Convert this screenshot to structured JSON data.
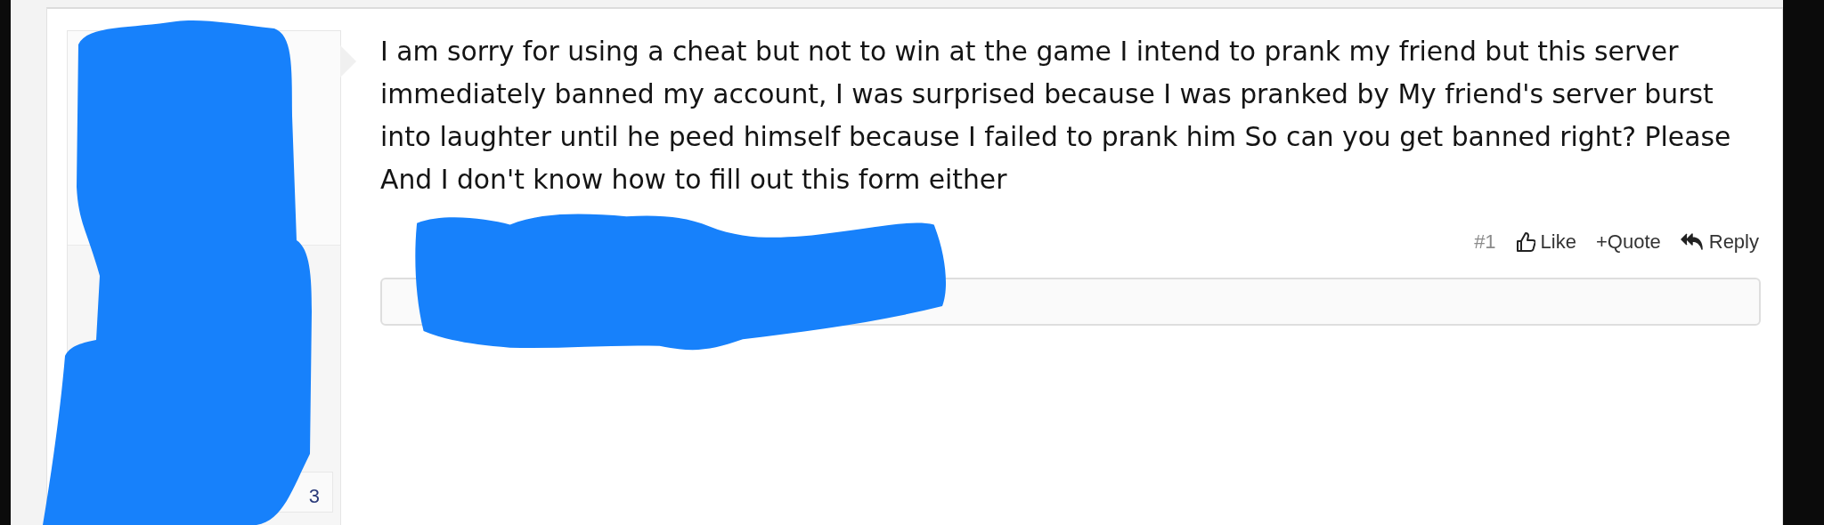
{
  "post": {
    "author": {
      "stat_value": "3"
    },
    "message": "I am sorry for using a cheat but not to win at the game I intend to prank my friend but this server immediately banned my account, I was surprised because I was pranked by My friend's server burst into laughter until he peed himself because I failed to prank him So can you get banned right? Please And I don't know how to fill out this form either",
    "number": "#1",
    "actions": [
      {
        "kind": "like",
        "label": "Like"
      },
      {
        "kind": "quote",
        "label": "Quote",
        "prefix": "+"
      },
      {
        "kind": "reply",
        "label": "Reply"
      }
    ]
  },
  "redactions": [
    {
      "kind": "scribble"
    },
    {
      "kind": "scribble"
    }
  ]
}
